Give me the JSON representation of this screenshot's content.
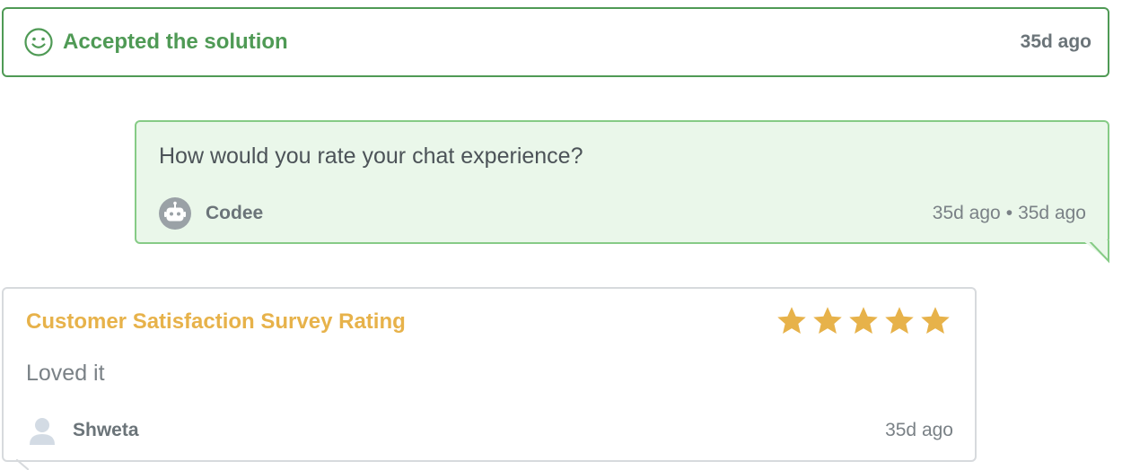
{
  "accepted_banner": {
    "icon": "smile-icon",
    "label": "Accepted the solution",
    "time": "35d ago",
    "color": "#4f9a55"
  },
  "bot_message": {
    "text": "How would you rate your chat experience?",
    "sender_icon": "robot-icon",
    "sender_name": "Codee",
    "time_1": "35d ago",
    "separator": "•",
    "time_2": "35d ago",
    "bg_color": "#eaf7ea",
    "border_color": "#86cb86"
  },
  "survey": {
    "title": "Customer Satisfaction Survey Rating",
    "rating": 5,
    "max_rating": 5,
    "star_icon": "star-icon",
    "comment": "Loved it",
    "user_icon": "user-avatar-icon",
    "user_name": "Shweta",
    "time": "35d ago",
    "accent_color": "#e7b24a"
  }
}
